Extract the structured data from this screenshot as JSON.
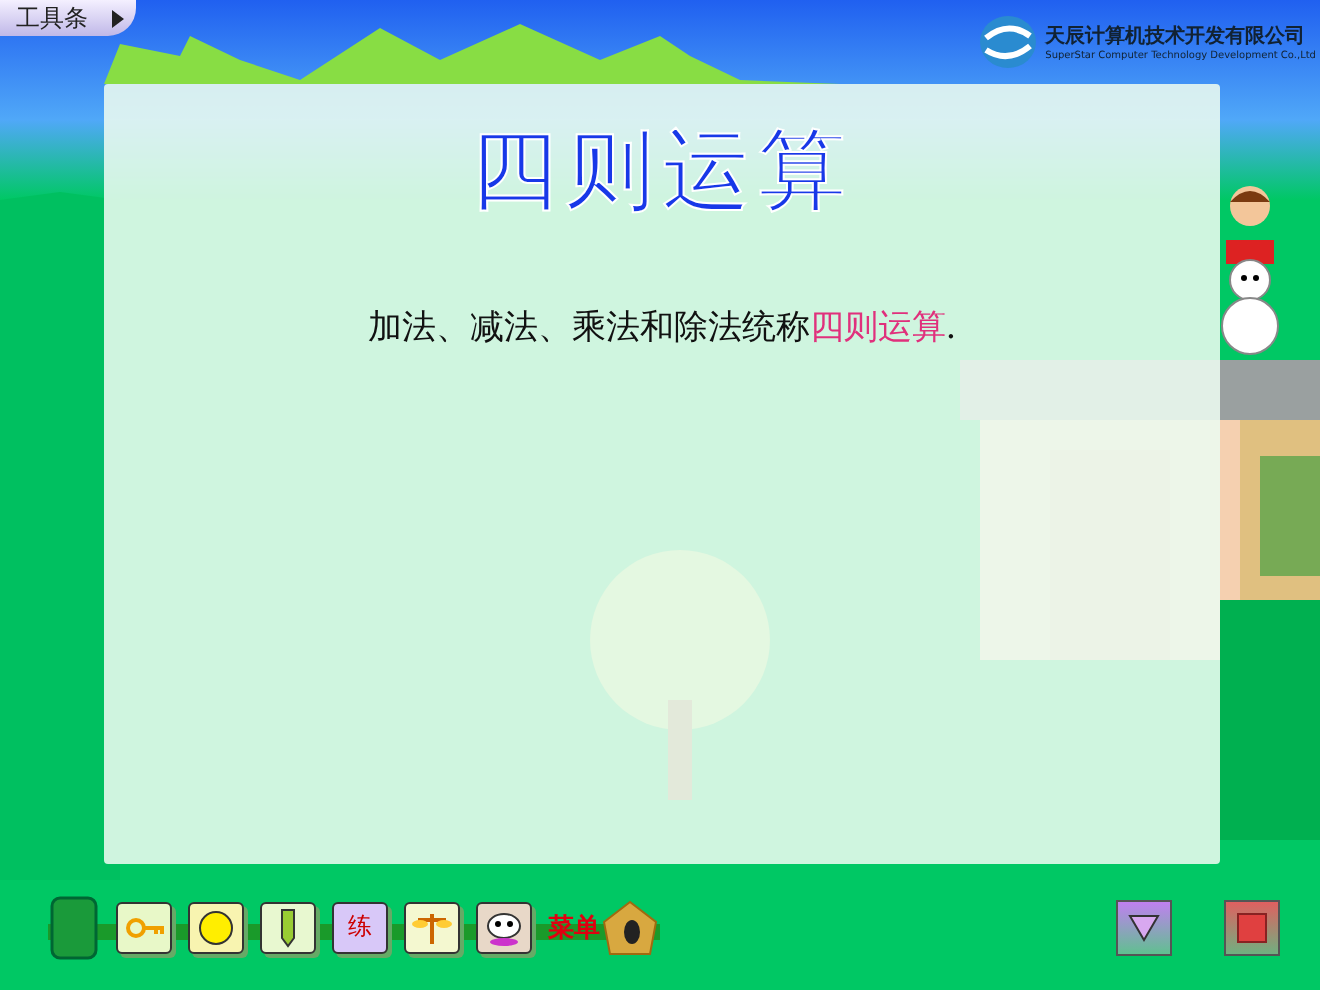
{
  "toolbar_tab": {
    "label": "工具条"
  },
  "company": {
    "name": "天辰计算机技术开发有限公司",
    "english": "SuperStar Computer Technology Development Co.,Ltd"
  },
  "lesson": {
    "title": "四则运算",
    "sentence": "加法、减法、乘法和除法统称",
    "term": "四则运算",
    "end": "."
  },
  "tools": [
    {
      "kind": "key"
    },
    {
      "kind": "circle"
    },
    {
      "kind": "pencil"
    },
    {
      "kind": "text",
      "label": "练"
    },
    {
      "kind": "scale"
    },
    {
      "kind": "robot"
    }
  ],
  "menu": {
    "label": "菜单"
  },
  "nav": [
    {
      "kind": "down"
    },
    {
      "kind": "stop"
    }
  ]
}
